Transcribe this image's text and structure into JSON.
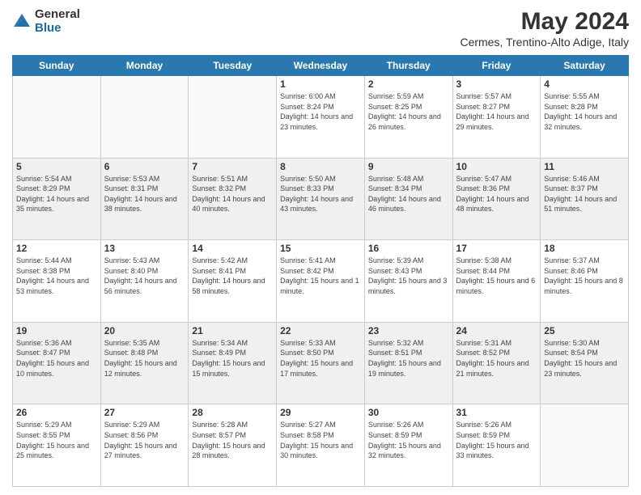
{
  "logo": {
    "general": "General",
    "blue": "Blue"
  },
  "title": "May 2024",
  "subtitle": "Cermes, Trentino-Alto Adige, Italy",
  "weekdays": [
    "Sunday",
    "Monday",
    "Tuesday",
    "Wednesday",
    "Thursday",
    "Friday",
    "Saturday"
  ],
  "weeks": [
    [
      {
        "day": "",
        "sunrise": "",
        "sunset": "",
        "daylight": ""
      },
      {
        "day": "",
        "sunrise": "",
        "sunset": "",
        "daylight": ""
      },
      {
        "day": "",
        "sunrise": "",
        "sunset": "",
        "daylight": ""
      },
      {
        "day": "1",
        "sunrise": "Sunrise: 6:00 AM",
        "sunset": "Sunset: 8:24 PM",
        "daylight": "Daylight: 14 hours and 23 minutes."
      },
      {
        "day": "2",
        "sunrise": "Sunrise: 5:59 AM",
        "sunset": "Sunset: 8:25 PM",
        "daylight": "Daylight: 14 hours and 26 minutes."
      },
      {
        "day": "3",
        "sunrise": "Sunrise: 5:57 AM",
        "sunset": "Sunset: 8:27 PM",
        "daylight": "Daylight: 14 hours and 29 minutes."
      },
      {
        "day": "4",
        "sunrise": "Sunrise: 5:55 AM",
        "sunset": "Sunset: 8:28 PM",
        "daylight": "Daylight: 14 hours and 32 minutes."
      }
    ],
    [
      {
        "day": "5",
        "sunrise": "Sunrise: 5:54 AM",
        "sunset": "Sunset: 8:29 PM",
        "daylight": "Daylight: 14 hours and 35 minutes."
      },
      {
        "day": "6",
        "sunrise": "Sunrise: 5:53 AM",
        "sunset": "Sunset: 8:31 PM",
        "daylight": "Daylight: 14 hours and 38 minutes."
      },
      {
        "day": "7",
        "sunrise": "Sunrise: 5:51 AM",
        "sunset": "Sunset: 8:32 PM",
        "daylight": "Daylight: 14 hours and 40 minutes."
      },
      {
        "day": "8",
        "sunrise": "Sunrise: 5:50 AM",
        "sunset": "Sunset: 8:33 PM",
        "daylight": "Daylight: 14 hours and 43 minutes."
      },
      {
        "day": "9",
        "sunrise": "Sunrise: 5:48 AM",
        "sunset": "Sunset: 8:34 PM",
        "daylight": "Daylight: 14 hours and 46 minutes."
      },
      {
        "day": "10",
        "sunrise": "Sunrise: 5:47 AM",
        "sunset": "Sunset: 8:36 PM",
        "daylight": "Daylight: 14 hours and 48 minutes."
      },
      {
        "day": "11",
        "sunrise": "Sunrise: 5:46 AM",
        "sunset": "Sunset: 8:37 PM",
        "daylight": "Daylight: 14 hours and 51 minutes."
      }
    ],
    [
      {
        "day": "12",
        "sunrise": "Sunrise: 5:44 AM",
        "sunset": "Sunset: 8:38 PM",
        "daylight": "Daylight: 14 hours and 53 minutes."
      },
      {
        "day": "13",
        "sunrise": "Sunrise: 5:43 AM",
        "sunset": "Sunset: 8:40 PM",
        "daylight": "Daylight: 14 hours and 56 minutes."
      },
      {
        "day": "14",
        "sunrise": "Sunrise: 5:42 AM",
        "sunset": "Sunset: 8:41 PM",
        "daylight": "Daylight: 14 hours and 58 minutes."
      },
      {
        "day": "15",
        "sunrise": "Sunrise: 5:41 AM",
        "sunset": "Sunset: 8:42 PM",
        "daylight": "Daylight: 15 hours and 1 minute."
      },
      {
        "day": "16",
        "sunrise": "Sunrise: 5:39 AM",
        "sunset": "Sunset: 8:43 PM",
        "daylight": "Daylight: 15 hours and 3 minutes."
      },
      {
        "day": "17",
        "sunrise": "Sunrise: 5:38 AM",
        "sunset": "Sunset: 8:44 PM",
        "daylight": "Daylight: 15 hours and 6 minutes."
      },
      {
        "day": "18",
        "sunrise": "Sunrise: 5:37 AM",
        "sunset": "Sunset: 8:46 PM",
        "daylight": "Daylight: 15 hours and 8 minutes."
      }
    ],
    [
      {
        "day": "19",
        "sunrise": "Sunrise: 5:36 AM",
        "sunset": "Sunset: 8:47 PM",
        "daylight": "Daylight: 15 hours and 10 minutes."
      },
      {
        "day": "20",
        "sunrise": "Sunrise: 5:35 AM",
        "sunset": "Sunset: 8:48 PM",
        "daylight": "Daylight: 15 hours and 12 minutes."
      },
      {
        "day": "21",
        "sunrise": "Sunrise: 5:34 AM",
        "sunset": "Sunset: 8:49 PM",
        "daylight": "Daylight: 15 hours and 15 minutes."
      },
      {
        "day": "22",
        "sunrise": "Sunrise: 5:33 AM",
        "sunset": "Sunset: 8:50 PM",
        "daylight": "Daylight: 15 hours and 17 minutes."
      },
      {
        "day": "23",
        "sunrise": "Sunrise: 5:32 AM",
        "sunset": "Sunset: 8:51 PM",
        "daylight": "Daylight: 15 hours and 19 minutes."
      },
      {
        "day": "24",
        "sunrise": "Sunrise: 5:31 AM",
        "sunset": "Sunset: 8:52 PM",
        "daylight": "Daylight: 15 hours and 21 minutes."
      },
      {
        "day": "25",
        "sunrise": "Sunrise: 5:30 AM",
        "sunset": "Sunset: 8:54 PM",
        "daylight": "Daylight: 15 hours and 23 minutes."
      }
    ],
    [
      {
        "day": "26",
        "sunrise": "Sunrise: 5:29 AM",
        "sunset": "Sunset: 8:55 PM",
        "daylight": "Daylight: 15 hours and 25 minutes."
      },
      {
        "day": "27",
        "sunrise": "Sunrise: 5:29 AM",
        "sunset": "Sunset: 8:56 PM",
        "daylight": "Daylight: 15 hours and 27 minutes."
      },
      {
        "day": "28",
        "sunrise": "Sunrise: 5:28 AM",
        "sunset": "Sunset: 8:57 PM",
        "daylight": "Daylight: 15 hours and 28 minutes."
      },
      {
        "day": "29",
        "sunrise": "Sunrise: 5:27 AM",
        "sunset": "Sunset: 8:58 PM",
        "daylight": "Daylight: 15 hours and 30 minutes."
      },
      {
        "day": "30",
        "sunrise": "Sunrise: 5:26 AM",
        "sunset": "Sunset: 8:59 PM",
        "daylight": "Daylight: 15 hours and 32 minutes."
      },
      {
        "day": "31",
        "sunrise": "Sunrise: 5:26 AM",
        "sunset": "Sunset: 8:59 PM",
        "daylight": "Daylight: 15 hours and 33 minutes."
      },
      {
        "day": "",
        "sunrise": "",
        "sunset": "",
        "daylight": ""
      }
    ]
  ]
}
